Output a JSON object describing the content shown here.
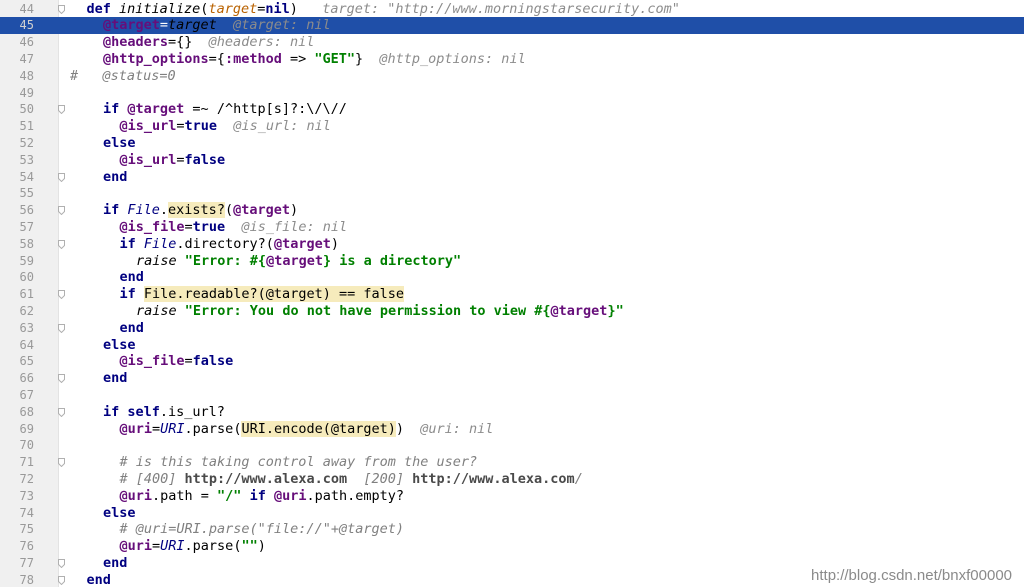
{
  "editor": {
    "first_line": 44,
    "current_line": 45,
    "lines": [
      {
        "n": "44",
        "fold": true,
        "indent": 1,
        "tokens": [
          [
            "kw",
            "def "
          ],
          [
            "fn",
            "initialize"
          ],
          [
            "",
            "("
          ],
          [
            "param",
            "target"
          ],
          [
            "",
            "="
          ],
          [
            "kw",
            "nil"
          ],
          [
            "",
            ")"
          ],
          [
            "hint",
            "   target: \"http://www.morningstarsecurity.com\""
          ]
        ]
      },
      {
        "n": "45",
        "fold": false,
        "indent": 2,
        "tokens": [
          [
            "ivar",
            "@target"
          ],
          [
            "",
            "="
          ],
          [
            "fn",
            "target"
          ],
          [
            "hint",
            "  @target: nil"
          ]
        ]
      },
      {
        "n": "46",
        "fold": false,
        "indent": 2,
        "tokens": [
          [
            "ivar",
            "@headers"
          ],
          [
            "",
            "={}"
          ],
          [
            "hint",
            "  @headers: nil"
          ]
        ]
      },
      {
        "n": "47",
        "fold": false,
        "indent": 2,
        "tokens": [
          [
            "ivar",
            "@http_options"
          ],
          [
            "",
            "={"
          ],
          [
            "sym",
            ":method"
          ],
          [
            "",
            " => "
          ],
          [
            "str",
            "\"GET\""
          ],
          [
            "",
            "}"
          ],
          [
            "hint",
            "  @http_options: nil"
          ]
        ]
      },
      {
        "n": "48",
        "fold": false,
        "indent": 0,
        "tokens": [
          [
            "cmt",
            "#   @status=0"
          ]
        ]
      },
      {
        "n": "49",
        "fold": false,
        "indent": 0,
        "tokens": []
      },
      {
        "n": "50",
        "fold": true,
        "indent": 2,
        "tokens": [
          [
            "kw",
            "if "
          ],
          [
            "ivar",
            "@target"
          ],
          [
            "",
            " =~ "
          ],
          [
            "regex",
            "/^http[s]?:\\/\\//"
          ]
        ]
      },
      {
        "n": "51",
        "fold": false,
        "indent": 3,
        "tokens": [
          [
            "ivar",
            "@is_url"
          ],
          [
            "",
            "="
          ],
          [
            "kw",
            "true"
          ],
          [
            "hint",
            "  @is_url: nil"
          ]
        ]
      },
      {
        "n": "52",
        "fold": false,
        "indent": 2,
        "tokens": [
          [
            "kw",
            "else"
          ]
        ]
      },
      {
        "n": "53",
        "fold": false,
        "indent": 3,
        "tokens": [
          [
            "ivar",
            "@is_url"
          ],
          [
            "",
            "="
          ],
          [
            "kw",
            "false"
          ]
        ]
      },
      {
        "n": "54",
        "fold": true,
        "indent": 2,
        "tokens": [
          [
            "kw",
            "end"
          ]
        ]
      },
      {
        "n": "55",
        "fold": false,
        "indent": 0,
        "tokens": []
      },
      {
        "n": "56",
        "fold": true,
        "indent": 2,
        "tokens": [
          [
            "kw",
            "if "
          ],
          [
            "const",
            "File"
          ],
          [
            "",
            "."
          ],
          [
            "hl",
            "exists?"
          ],
          [
            "",
            "("
          ],
          [
            "ivar",
            "@target"
          ],
          [
            "",
            ")"
          ]
        ]
      },
      {
        "n": "57",
        "fold": false,
        "indent": 3,
        "tokens": [
          [
            "ivar",
            "@is_file"
          ],
          [
            "",
            "="
          ],
          [
            "kw",
            "true"
          ],
          [
            "hint",
            "  @is_file: nil"
          ]
        ]
      },
      {
        "n": "58",
        "fold": true,
        "indent": 3,
        "tokens": [
          [
            "kw",
            "if "
          ],
          [
            "const",
            "File"
          ],
          [
            "",
            ".directory?("
          ],
          [
            "ivar",
            "@target"
          ],
          [
            "",
            ")"
          ]
        ]
      },
      {
        "n": "59",
        "fold": false,
        "indent": 4,
        "tokens": [
          [
            "fn",
            "raise "
          ],
          [
            "str",
            "\"Error: #{"
          ],
          [
            "ivar",
            "@target"
          ],
          [
            "str",
            "} is a directory\""
          ]
        ]
      },
      {
        "n": "60",
        "fold": false,
        "indent": 3,
        "tokens": [
          [
            "kw",
            "end"
          ]
        ]
      },
      {
        "n": "61",
        "fold": true,
        "indent": 3,
        "tokens": [
          [
            "kw",
            "if "
          ],
          [
            "hl",
            "File.readable?(@target) == false"
          ]
        ]
      },
      {
        "n": "62",
        "fold": false,
        "indent": 4,
        "tokens": [
          [
            "fn",
            "raise "
          ],
          [
            "str",
            "\"Error: You do not have permission to view #{"
          ],
          [
            "ivar",
            "@target"
          ],
          [
            "str",
            "}\""
          ]
        ]
      },
      {
        "n": "63",
        "fold": true,
        "indent": 3,
        "tokens": [
          [
            "kw",
            "end"
          ]
        ]
      },
      {
        "n": "64",
        "fold": false,
        "indent": 2,
        "tokens": [
          [
            "kw",
            "else"
          ]
        ]
      },
      {
        "n": "65",
        "fold": false,
        "indent": 3,
        "tokens": [
          [
            "ivar",
            "@is_file"
          ],
          [
            "",
            "="
          ],
          [
            "kw",
            "false"
          ]
        ]
      },
      {
        "n": "66",
        "fold": true,
        "indent": 2,
        "tokens": [
          [
            "kw",
            "end"
          ]
        ]
      },
      {
        "n": "67",
        "fold": false,
        "indent": 0,
        "tokens": []
      },
      {
        "n": "68",
        "fold": true,
        "indent": 2,
        "tokens": [
          [
            "kw",
            "if self"
          ],
          [
            "",
            ".is_url?"
          ]
        ]
      },
      {
        "n": "69",
        "fold": false,
        "indent": 3,
        "tokens": [
          [
            "ivar",
            "@uri"
          ],
          [
            "",
            "="
          ],
          [
            "const",
            "URI"
          ],
          [
            "",
            ".parse("
          ],
          [
            "hl",
            "URI.encode(@target)"
          ],
          [
            "",
            ")"
          ],
          [
            "hint",
            "  @uri: nil"
          ]
        ]
      },
      {
        "n": "70",
        "fold": false,
        "indent": 0,
        "tokens": []
      },
      {
        "n": "71",
        "fold": true,
        "indent": 3,
        "tokens": [
          [
            "cmt",
            "# is this taking control away from the user?"
          ]
        ]
      },
      {
        "n": "72",
        "fold": false,
        "indent": 3,
        "tokens": [
          [
            "cmt",
            "# [400] "
          ],
          [
            "url",
            "http://www.alexa.com"
          ],
          [
            "cmt",
            "  [200] "
          ],
          [
            "url",
            "http://www.alexa.com"
          ],
          [
            "cmt",
            "/"
          ]
        ]
      },
      {
        "n": "73",
        "fold": false,
        "indent": 3,
        "tokens": [
          [
            "ivar",
            "@uri"
          ],
          [
            "",
            ".path = "
          ],
          [
            "str",
            "\"/\""
          ],
          [
            "kw",
            " if "
          ],
          [
            "ivar",
            "@uri"
          ],
          [
            "",
            ".path.empty?"
          ]
        ]
      },
      {
        "n": "74",
        "fold": false,
        "indent": 2,
        "tokens": [
          [
            "kw",
            "else"
          ]
        ]
      },
      {
        "n": "75",
        "fold": false,
        "indent": 3,
        "tokens": [
          [
            "cmt",
            "# @uri=URI.parse(\"file://\"+@target)"
          ]
        ]
      },
      {
        "n": "76",
        "fold": false,
        "indent": 3,
        "tokens": [
          [
            "ivar",
            "@uri"
          ],
          [
            "",
            "="
          ],
          [
            "const",
            "URI"
          ],
          [
            "",
            ".parse("
          ],
          [
            "str",
            "\"\""
          ],
          [
            "",
            ")"
          ]
        ]
      },
      {
        "n": "77",
        "fold": true,
        "indent": 2,
        "tokens": [
          [
            "kw",
            "end"
          ]
        ]
      },
      {
        "n": "78",
        "fold": true,
        "indent": 1,
        "tokens": [
          [
            "kw",
            "end"
          ]
        ]
      }
    ]
  },
  "colors": {
    "current_line_bg": "#1f4fa8",
    "keyword": "#000080",
    "instance_var": "#660e7a",
    "string": "#008000",
    "comment": "#808080",
    "highlight_bg": "#f6ebbc"
  },
  "watermark": "http://blog.csdn.net/bnxf00000",
  "icons": {
    "fold": "fold-marker-icon"
  }
}
